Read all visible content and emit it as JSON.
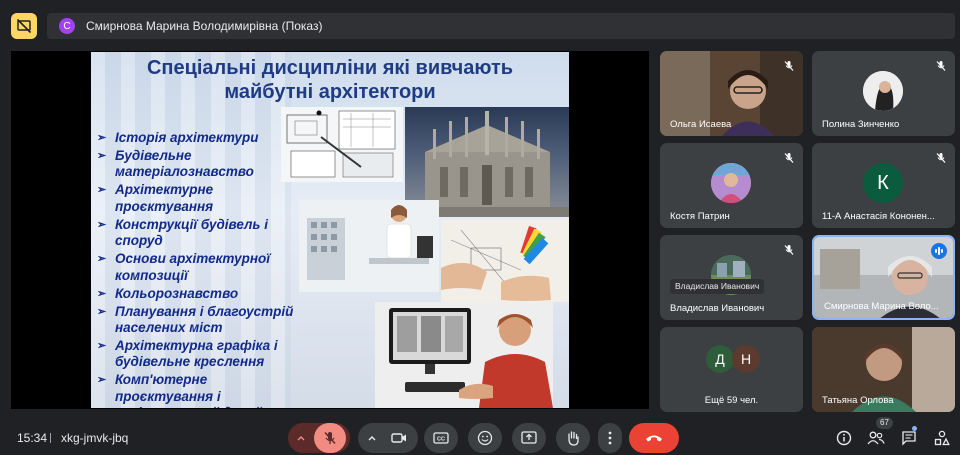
{
  "presenting": {
    "initial": "С",
    "label": "Смирнова Марина Володимирівна (Показ)"
  },
  "slide": {
    "title_line1": "Спеціальні дисципліни які вивчають",
    "title_line2": "майбутні архітектори",
    "items": [
      "Історія архітектури",
      "Будівельне матеріалознавство",
      "Архітектурне проєктування",
      "Конструкції будівель і споруд",
      "Основи архітектурної композиції",
      "Кольорознавство",
      "Планування і благоустрій населених міст",
      "Архітектурна графіка і будівельне креслення",
      "Комп'ютерне проєктування і архітектурний дизайн"
    ]
  },
  "participants": [
    {
      "name": "Ольга Исаева",
      "kind": "video"
    },
    {
      "name": "Полина Зинченко",
      "kind": "photo"
    },
    {
      "name": "Костя Патрин",
      "kind": "photo"
    },
    {
      "name": "11-А Анастасія Кононен...",
      "kind": "letter",
      "initial": "К",
      "color": "#0b5c3f"
    },
    {
      "name": "Владислав Иванович",
      "kind": "photo",
      "tooltip": "Владислав Иванович"
    },
    {
      "name": "Смирнова Марина Воло...",
      "kind": "video",
      "speaking": true
    },
    {
      "name": "Ещё 59 чел.",
      "kind": "others",
      "initials": [
        "Д",
        "Н"
      ]
    },
    {
      "name": "Татьяна Орлова",
      "kind": "video"
    }
  ],
  "bottom": {
    "time": "15:34",
    "meeting_code": "xkg-jmvk-jbq",
    "participant_count": "67"
  },
  "colors": {
    "background": "#202124",
    "control": "#3c4043",
    "mic_off": "#f28b82",
    "mic_off_bg": "#5c2b29",
    "end_call": "#ea4335",
    "presenting_badge": "#fdd663",
    "active_speaker": "#8ab4f8",
    "slide_text": "#122a8a"
  },
  "icons": [
    "present-off-icon",
    "mic-off-icon",
    "chevron-up-icon",
    "camera-icon",
    "captions-icon",
    "emoji-icon",
    "present-icon",
    "raise-hand-icon",
    "more-icon",
    "end-call-icon",
    "info-icon",
    "people-icon",
    "chat-icon",
    "activities-icon",
    "audio-active-icon"
  ]
}
